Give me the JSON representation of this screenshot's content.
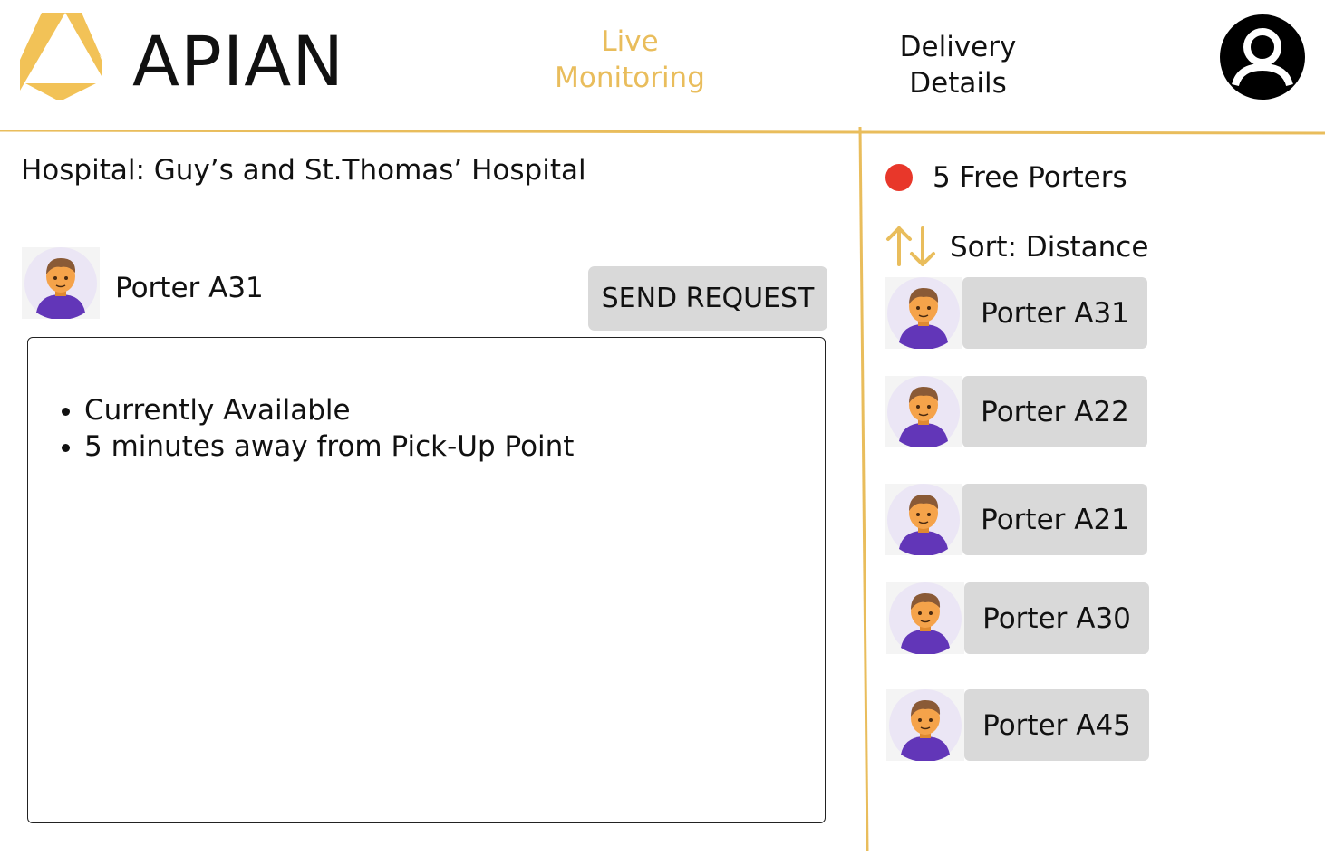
{
  "header": {
    "brand": "APIAN",
    "nav": [
      {
        "label_line1": "Live",
        "label_line2": "Monitoring",
        "active": true
      },
      {
        "label_line1": "Delivery",
        "label_line2": "Details",
        "active": false
      }
    ],
    "icons": {
      "logo": "apian-logo-icon",
      "profile": "user-profile-icon"
    }
  },
  "colors": {
    "accent": "#e9bd5c",
    "divider": "#e9bd5c",
    "button_bg": "#d9d9d9",
    "status_dot": "#e8372a",
    "avatar_bg": "#ebe6f5",
    "avatar_shirt": "#6236b8",
    "avatar_skin": "#f5a34a",
    "avatar_hair": "#8a5a36"
  },
  "main": {
    "hospital": "Hospital: Guy’s and St.Thomas’ Hospital",
    "selected_porter": {
      "name": "Porter A31",
      "details": [
        "Currently Available",
        "5 minutes away from Pick-Up Point"
      ]
    },
    "send_button": "SEND REQUEST"
  },
  "sidebar": {
    "free_count_label": "5 Free Porters",
    "sort_label": "Sort: Distance",
    "porters": [
      {
        "name": "Porter A31"
      },
      {
        "name": "Porter A22"
      },
      {
        "name": "Porter A21"
      },
      {
        "name": "Porter A30"
      },
      {
        "name": "Porter A45"
      }
    ]
  }
}
